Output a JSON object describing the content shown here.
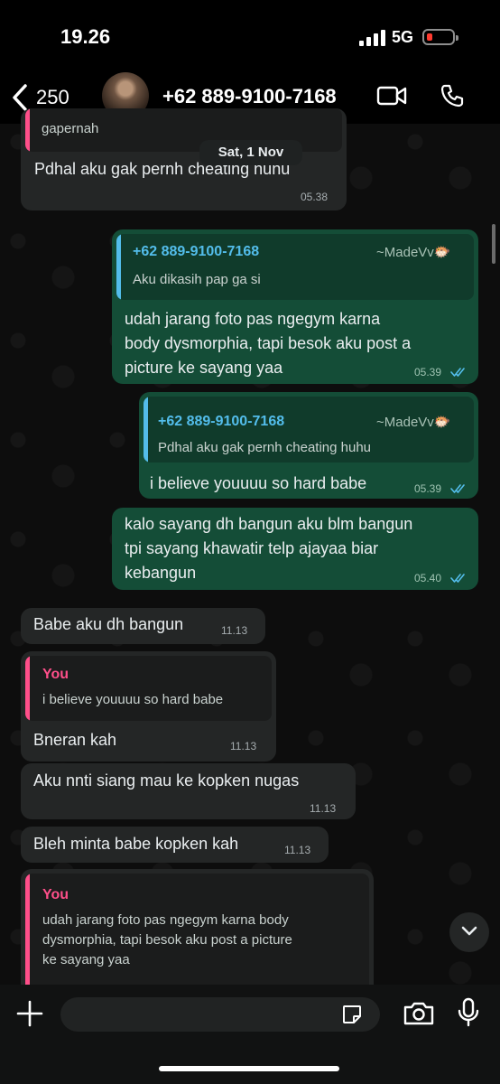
{
  "status": {
    "time": "19.26",
    "network": "5G"
  },
  "header": {
    "back_count": "250",
    "contact_name": "+62 889-9100-7168"
  },
  "date_chip": "Sat, 1 Nov",
  "messages": [
    {
      "quote_text": "gapernah",
      "text": "Pdhal aku gak pernh cheating huhu",
      "time": "05.38"
    },
    {
      "quote_name": "+62 889-9100-7168",
      "quote_handle": "~MadeVv🐡",
      "quote_text": "Aku dikasih pap ga si",
      "lines": [
        "udah jarang foto pas ngegym karna",
        "body dysmorphia, tapi besok aku post a",
        "picture ke sayang yaa"
      ],
      "time": "05.39"
    },
    {
      "quote_name": "+62 889-9100-7168",
      "quote_handle": "~MadeVv🐡",
      "quote_text": "Pdhal aku gak pernh cheating huhu",
      "text": "i believe youuuu so hard babe",
      "time": "05.39"
    },
    {
      "lines": [
        "kalo sayang dh bangun aku blm bangun",
        "tpi sayang khawatir telp ajayaa biar",
        "kebangun"
      ],
      "time": "05.40"
    },
    {
      "text": "Babe aku dh bangun",
      "time": "11.13"
    },
    {
      "quote_name": "You",
      "quote_text": "i believe youuuu so hard babe",
      "text": "Bneran kah",
      "time": "11.13"
    },
    {
      "text": "Aku nnti siang mau ke kopken nugas",
      "time": "11.13"
    },
    {
      "text": "Bleh minta babe kopken kah",
      "time": "11.13"
    },
    {
      "quote_name": "You",
      "quote_lines": [
        "udah jarang foto pas ngegym karna body",
        "dysmorphia, tapi besok aku post a picture",
        "ke sayang yaa"
      ]
    }
  ],
  "colors": {
    "incoming": "#242626",
    "outgoing": "#144d37",
    "quote_blue": "#53bdeb",
    "quote_pink": "#ff4f8a"
  }
}
